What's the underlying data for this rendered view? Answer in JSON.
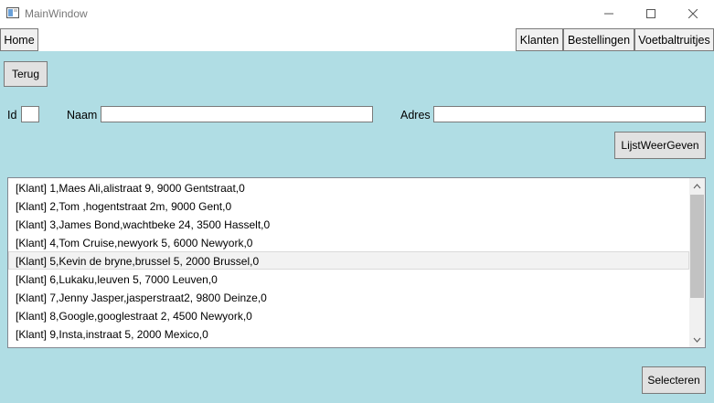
{
  "window": {
    "title": "MainWindow",
    "icon": "app-window-icon"
  },
  "tabs": {
    "home": "Home",
    "klanten": "Klanten",
    "bestellingen": "Bestellingen",
    "voetbaltruitjes": "Voetbaltruitjes"
  },
  "buttons": {
    "terug": "Terug",
    "lijst_weer_geven": "LijstWeerGeven",
    "selecteren": "Selecteren"
  },
  "form": {
    "id_label": "Id",
    "id_value": "",
    "naam_label": "Naam",
    "naam_value": "",
    "adres_label": "Adres",
    "adres_value": ""
  },
  "list": {
    "items": [
      "[Klant] 1,Maes Ali,alistraat 9, 9000 Gentstraat,0",
      "[Klant] 2,Tom ,hogentstraat 2m, 9000 Gent,0",
      "[Klant] 3,James Bond,wachtbeke 24, 3500 Hasselt,0",
      "[Klant] 4,Tom Cruise,newyork 5, 6000 Newyork,0",
      "[Klant] 5,Kevin de bryne,brussel 5, 2000 Brussel,0",
      "[Klant] 6,Lukaku,leuven 5, 7000 Leuven,0",
      "[Klant] 7,Jenny Jasper,jasperstraat2, 9800 Deinze,0",
      "[Klant] 8,Google,googlestraat 2, 4500 Newyork,0",
      "[Klant] 9,Insta,instraat 5, 2000 Mexico,0"
    ],
    "highlighted_index": 4
  },
  "colors": {
    "content_background": "#b0dde4",
    "button_background": "#e1e1e1"
  }
}
